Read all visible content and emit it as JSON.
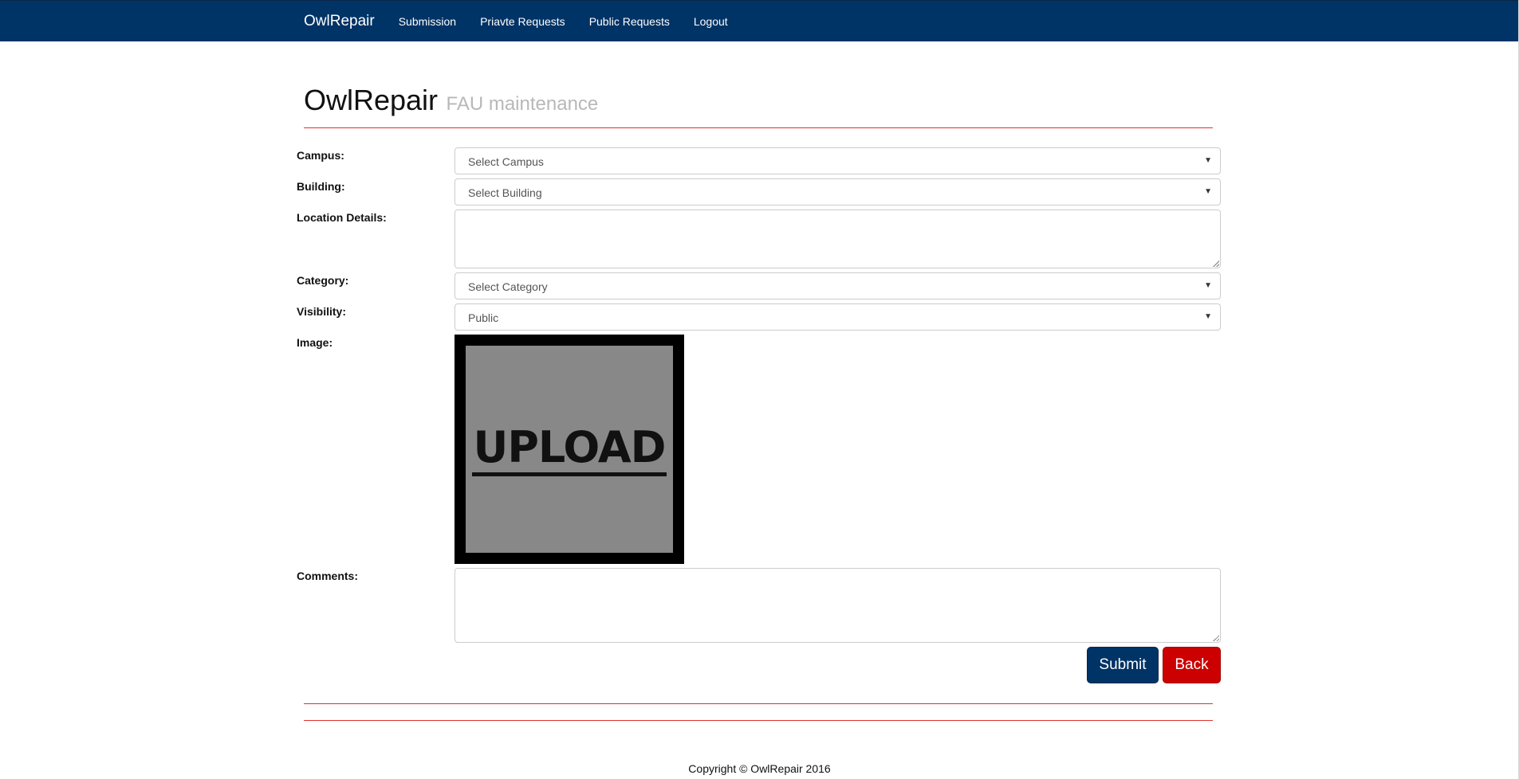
{
  "nav": {
    "brand": "OwlRepair",
    "links": [
      "Submission",
      "Priavte Requests",
      "Public Requests",
      "Logout"
    ]
  },
  "header": {
    "title": "OwlRepair",
    "subtitle": "FAU maintenance"
  },
  "form": {
    "campus": {
      "label": "Campus:",
      "value": "Select Campus"
    },
    "building": {
      "label": "Building:",
      "value": "Select Building"
    },
    "location": {
      "label": "Location Details:",
      "value": ""
    },
    "category": {
      "label": "Category:",
      "value": "Select Category"
    },
    "visibility": {
      "label": "Visibility:",
      "value": "Public"
    },
    "image": {
      "label": "Image:",
      "upload_text": "UPLOAD"
    },
    "comments": {
      "label": "Comments:",
      "value": ""
    }
  },
  "buttons": {
    "submit": "Submit",
    "back": "Back"
  },
  "footer": {
    "text": "Copyright © OwlRepair 2016"
  },
  "colors": {
    "navbar": "#003366",
    "accent_red": "#cc0000",
    "divider": "#e03030"
  }
}
